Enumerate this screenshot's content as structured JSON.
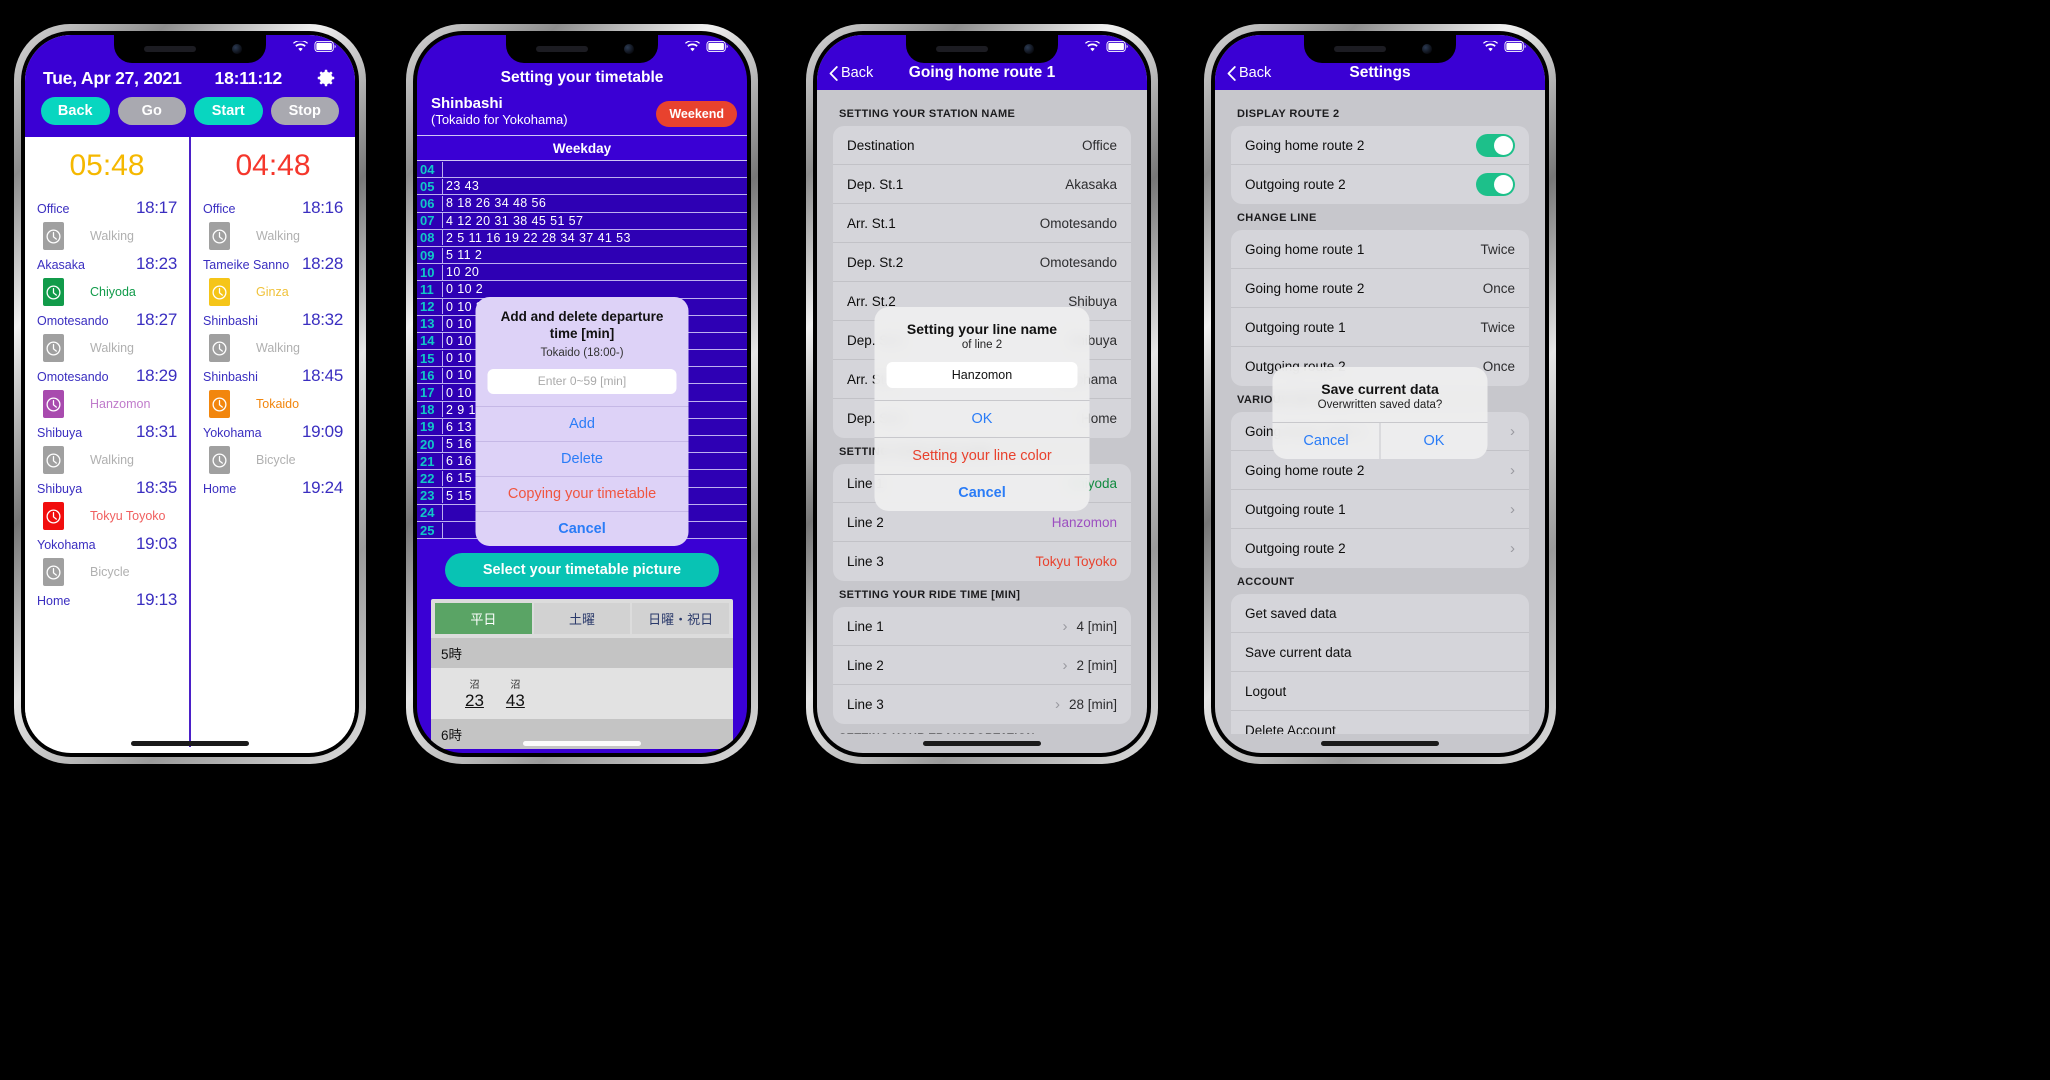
{
  "phone1": {
    "header": {
      "date": "Tue, Apr 27, 2021",
      "clock": "18:11:12",
      "gear_icon": "gear-icon"
    },
    "buttons": [
      {
        "label": "Back",
        "style": "teal"
      },
      {
        "label": "Go",
        "style": "grey"
      },
      {
        "label": "Start",
        "style": "teal"
      },
      {
        "label": "Stop",
        "style": "grey"
      }
    ],
    "left": {
      "countdown": "05:48",
      "countdown_color": "#f5b800",
      "legs": [
        {
          "kind": "stop",
          "name": "Office",
          "time": "18:17"
        },
        {
          "kind": "mode",
          "label": "Walking",
          "color": "#a0a0a0",
          "text_color": "#b0b0b0"
        },
        {
          "kind": "stop",
          "name": "Akasaka",
          "time": "18:23"
        },
        {
          "kind": "mode",
          "label": "Chiyoda",
          "color": "#119b4a",
          "text_color": "#119b4a"
        },
        {
          "kind": "stop",
          "name": "Omotesando",
          "time": "18:27"
        },
        {
          "kind": "mode",
          "label": "Walking",
          "color": "#a0a0a0",
          "text_color": "#b0b0b0"
        },
        {
          "kind": "stop",
          "name": "Omotesando",
          "time": "18:29"
        },
        {
          "kind": "mode",
          "label": "Hanzomon",
          "color": "#a84bae",
          "text_color": "#c07bcb"
        },
        {
          "kind": "stop",
          "name": "Shibuya",
          "time": "18:31"
        },
        {
          "kind": "mode",
          "label": "Walking",
          "color": "#a0a0a0",
          "text_color": "#b0b0b0"
        },
        {
          "kind": "stop",
          "name": "Shibuya",
          "time": "18:35"
        },
        {
          "kind": "mode",
          "label": "Tokyu Toyoko",
          "color": "#f10d0d",
          "text_color": "#f06060"
        },
        {
          "kind": "stop",
          "name": "Yokohama",
          "time": "19:03"
        },
        {
          "kind": "mode",
          "label": "Bicycle",
          "color": "#a0a0a0",
          "text_color": "#b0b0b0"
        },
        {
          "kind": "stop",
          "name": "Home",
          "time": "19:13"
        }
      ]
    },
    "right": {
      "countdown": "04:48",
      "countdown_color": "#f5372c",
      "legs": [
        {
          "kind": "stop",
          "name": "Office",
          "time": "18:16"
        },
        {
          "kind": "mode",
          "label": "Walking",
          "color": "#a0a0a0",
          "text_color": "#b0b0b0"
        },
        {
          "kind": "stop",
          "name": "Tameike Sanno",
          "time": "18:28"
        },
        {
          "kind": "mode",
          "label": "Ginza",
          "color": "#f5c518",
          "text_color": "#f0c23a"
        },
        {
          "kind": "stop",
          "name": "Shinbashi",
          "time": "18:32"
        },
        {
          "kind": "mode",
          "label": "Walking",
          "color": "#a0a0a0",
          "text_color": "#b0b0b0"
        },
        {
          "kind": "stop",
          "name": "Shinbashi",
          "time": "18:45"
        },
        {
          "kind": "mode",
          "label": "Tokaido",
          "color": "#f2860d",
          "text_color": "#f2860d"
        },
        {
          "kind": "stop",
          "name": "Yokohama",
          "time": "19:09"
        },
        {
          "kind": "mode",
          "label": "Bicycle",
          "color": "#a0a0a0",
          "text_color": "#b0b0b0"
        },
        {
          "kind": "stop",
          "name": "Home",
          "time": "19:24"
        }
      ]
    }
  },
  "phone2": {
    "title": "Setting your timetable",
    "station": "Shinbashi",
    "direction": "(Tokaido for Yokohama)",
    "weekend_badge": "Weekend",
    "table_header": "Weekday",
    "timetable": [
      {
        "hour": "04",
        "mins": ""
      },
      {
        "hour": "05",
        "mins": "23 43"
      },
      {
        "hour": "06",
        "mins": "8 18 26 34 48 56"
      },
      {
        "hour": "07",
        "mins": "4 12 20 31 38 45 51 57"
      },
      {
        "hour": "08",
        "mins": "2 5 11 16 19 22 28 34 37 41 53"
      },
      {
        "hour": "09",
        "mins": "5 11 2"
      },
      {
        "hour": "10",
        "mins": "10 20"
      },
      {
        "hour": "11",
        "mins": "0 10 2"
      },
      {
        "hour": "12",
        "mins": "0 10 2"
      },
      {
        "hour": "13",
        "mins": "0 10 2"
      },
      {
        "hour": "14",
        "mins": "0 10 2"
      },
      {
        "hour": "15",
        "mins": "0 10 2"
      },
      {
        "hour": "16",
        "mins": "0 10 2"
      },
      {
        "hour": "17",
        "mins": "0 10 2"
      },
      {
        "hour": "18",
        "mins": "2 9 16"
      },
      {
        "hour": "19",
        "mins": "6 13 2"
      },
      {
        "hour": "20",
        "mins": "5 16 2"
      },
      {
        "hour": "21",
        "mins": "6 16 2"
      },
      {
        "hour": "22",
        "mins": "6 15 2"
      },
      {
        "hour": "23",
        "mins": "5 15 2"
      },
      {
        "hour": "24",
        "mins": ""
      },
      {
        "hour": "25",
        "mins": ""
      }
    ],
    "select_picture_button": "Select your timetable picture",
    "picture": {
      "tabs": [
        "平日",
        "土曜",
        "日曜・祝日"
      ],
      "active_tab": "平日",
      "hours": [
        "5時",
        "6時"
      ],
      "cells": [
        {
          "kanji": "沼",
          "min": "23"
        },
        {
          "kanji": "沼",
          "min": "43"
        }
      ]
    },
    "modal": {
      "title": "Add and delete departure time [min]",
      "subtitle": "Tokaido (18:00-)",
      "input_value": "",
      "input_placeholder": "Enter 0~59 [min]",
      "actions": [
        {
          "label": "Add",
          "style": "blue"
        },
        {
          "label": "Delete",
          "style": "blue"
        },
        {
          "label": "Copying your timetable",
          "style": "red"
        },
        {
          "label": "Cancel",
          "style": "blue-bold"
        }
      ]
    }
  },
  "phone3": {
    "nav": {
      "back": "Back",
      "title": "Going home route 1"
    },
    "sections": [
      {
        "header": "SETTING YOUR STATION NAME",
        "rows": [
          {
            "label": "Destination",
            "value": "Office"
          },
          {
            "label": "Dep. St.1",
            "value": "Akasaka"
          },
          {
            "label": "Arr. St.1",
            "value": "Omotesando"
          },
          {
            "label": "Dep. St.2",
            "value": "Omotesando"
          },
          {
            "label": "Arr. St.2",
            "value": "Shibuya"
          },
          {
            "label": "Dep. St.3",
            "value": "Shibuya"
          },
          {
            "label": "Arr. St.3",
            "value": "Yokohama"
          },
          {
            "label": "Dep. St.4",
            "value": "Home"
          }
        ]
      },
      {
        "header": "SETTING YOUR LINE NAME",
        "rows": [
          {
            "label": "Line 1",
            "value": "Chiyoda",
            "value_color": "green"
          },
          {
            "label": "Line 2",
            "value": "Hanzomon",
            "value_color": "purple"
          },
          {
            "label": "Line 3",
            "value": "Tokyu Toyoko",
            "value_color": "red"
          }
        ]
      },
      {
        "header": "SETTING YOUR RIDE TIME [MIN]",
        "rows": [
          {
            "label": "Line 1",
            "value": "4 [min]",
            "chevron": true
          },
          {
            "label": "Line 2",
            "value": "2 [min]",
            "chevron": true
          },
          {
            "label": "Line 3",
            "value": "28 [min]",
            "chevron": true
          }
        ]
      },
      {
        "header": "SETTING YOUR TRANSPORTATION",
        "rows": []
      }
    ],
    "alert": {
      "title": "Setting your line name",
      "subtitle": "of line 2",
      "input_value": "Hanzomon",
      "actions": [
        {
          "label": "OK",
          "style": "blue"
        },
        {
          "label": "Setting your line color",
          "style": "red"
        },
        {
          "label": "Cancel",
          "style": "blue-bold"
        }
      ]
    }
  },
  "phone4": {
    "nav": {
      "back": "Back",
      "title": "Settings"
    },
    "sections": [
      {
        "header": "DISPLAY ROUTE 2",
        "rows": [
          {
            "label": "Going home route 2",
            "toggle": true
          },
          {
            "label": "Outgoing route 2",
            "toggle": true
          }
        ]
      },
      {
        "header": "CHANGE LINE",
        "rows": [
          {
            "label": "Going home route 1",
            "value": "Twice"
          },
          {
            "label": "Going home route 2",
            "value": "Once"
          },
          {
            "label": "Outgoing route 1",
            "value": "Twice"
          },
          {
            "label": "Outgoing route 2",
            "value": "Once"
          }
        ]
      },
      {
        "header": "VARIOUS SETTINGS",
        "rows": [
          {
            "label": "Going home route 1",
            "chevron": true
          },
          {
            "label": "Going home route 2",
            "chevron": true
          },
          {
            "label": "Outgoing route 1",
            "chevron": true
          },
          {
            "label": "Outgoing route 2",
            "chevron": true
          }
        ]
      },
      {
        "header": "ACCOUNT",
        "rows": [
          {
            "label": "Get saved data"
          },
          {
            "label": "Save current data"
          },
          {
            "label": "Logout"
          },
          {
            "label": "Delete Account"
          }
        ]
      }
    ],
    "alert": {
      "title": "Save current data",
      "subtitle": "Overwritten saved data?",
      "buttons": [
        {
          "label": "Cancel"
        },
        {
          "label": "OK"
        }
      ]
    }
  },
  "colors": {
    "brand_purple": "#3a00d4",
    "teal": "#08d6c0",
    "ios_blue": "#2a7cf7",
    "alert_red": "#e8422e"
  }
}
